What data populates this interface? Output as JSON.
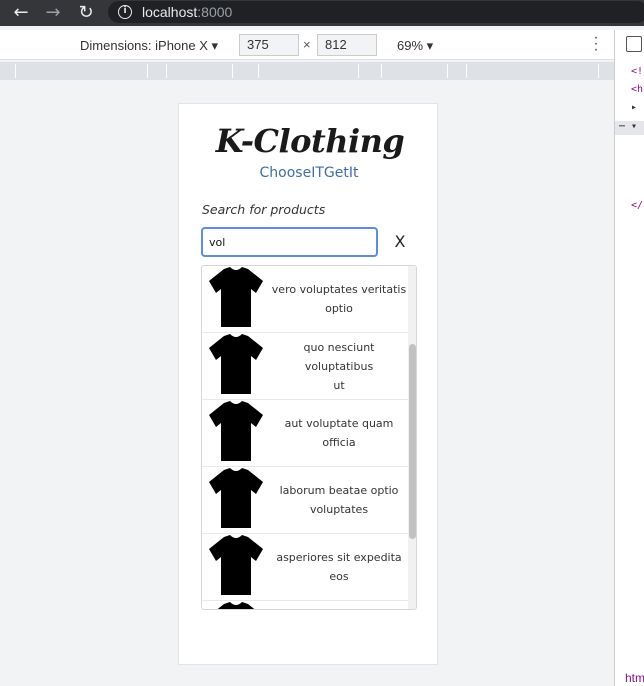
{
  "browser": {
    "url_host": "localhost",
    "url_port": ":8000"
  },
  "devtools": {
    "dimensions_label": "Dimensions: iPhone X",
    "width": "375",
    "height": "812",
    "times": "×",
    "zoom": "69%"
  },
  "app": {
    "logo_text": "K-Clothing",
    "tagline": "ChooseITGetIt",
    "search_label": "Search for products",
    "search_value": "vol",
    "clear_label": "X",
    "results": [
      {
        "name": "vero voluptates veritatis\noptio"
      },
      {
        "name": "quo nesciunt\nvoluptatibus\nut"
      },
      {
        "name": "aut voluptate quam\nofficia"
      },
      {
        "name": "laborum beatae optio\nvoluptates"
      },
      {
        "name": "asperiores sit expedita\neos"
      }
    ]
  }
}
